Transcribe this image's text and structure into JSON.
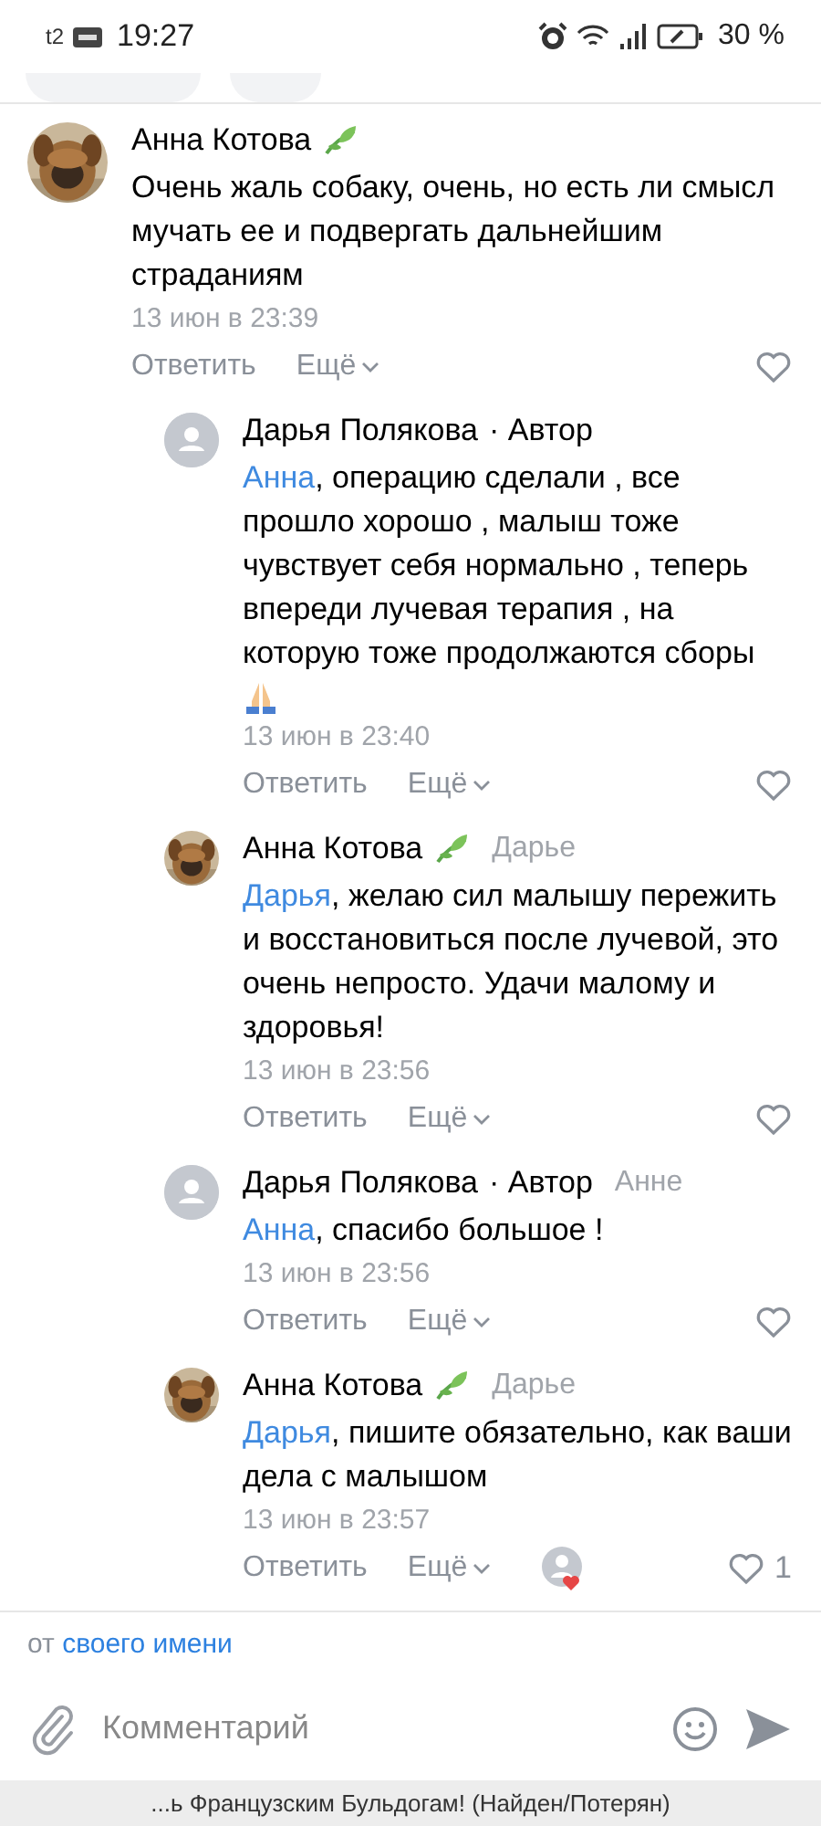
{
  "status_bar": {
    "carrier": "t2",
    "time": "19:27",
    "battery": "30 %"
  },
  "comments": [
    {
      "kind": "top",
      "author": "Анна Котова",
      "leaf_badge": true,
      "text": "Очень жаль собаку, очень, но есть ли смысл мучать ее и подвергать дальнейшим страданиям",
      "emoji": false,
      "date": "13 июн в 23:39",
      "reply": "Ответить",
      "more": "Ещё",
      "liked_by_avatar": false
    },
    {
      "kind": "reply",
      "avatar": {
        "kind": "placeholder"
      },
      "author": "Дарья Полякова",
      "leaf_badge": false,
      "author_tag": "· Автор",
      "mention": "Анна",
      "text": ", операцию сделали , все прошло хорошо , малыш тоже чувствует себя нормально , теперь впереди лучевая терапия , на которую тоже продолжаются сборы",
      "emoji": true,
      "date": "13 июн в 23:40",
      "reply": "Ответить",
      "more": "Ещё",
      "liked_by_avatar": false
    },
    {
      "kind": "reply",
      "author": "Анна Котова",
      "leaf_badge": true,
      "reply_to": "Дарье",
      "mention": "Дарья",
      "text": ", желаю сил малышу пережить и восстановиться после лучевой, это очень непросто. Удачи малому и здоровья!",
      "emoji": false,
      "date": "13 июн в 23:56",
      "reply": "Ответить",
      "more": "Ещё",
      "liked_by_avatar": false
    },
    {
      "kind": "reply",
      "avatar": {
        "kind": "placeholder"
      },
      "author": "Дарья Полякова",
      "leaf_badge": false,
      "author_tag": "· Автор",
      "reply_to": "Анне",
      "mention": "Анна",
      "text": ", спасибо большое !",
      "emoji": false,
      "date": "13 июн в 23:56",
      "reply": "Ответить",
      "more": "Ещё",
      "liked_by_avatar": false
    },
    {
      "kind": "reply",
      "author": "Анна Котова",
      "leaf_badge": true,
      "reply_to": "Дарье",
      "mention": "Дарья",
      "text": ", пишите обязательно, как ваши дела с малышом",
      "emoji": false,
      "date": "13 июн в 23:57",
      "reply": "Ответить",
      "more": "Ещё",
      "likes": "1",
      "liked_by_avatar": true
    }
  ],
  "composer": {
    "sender_prefix": "от",
    "sender_link": "своего имени",
    "placeholder": "Комментарий"
  },
  "footer_title": "...ь Французским Бульдогам! (Найден/Потерян)"
}
